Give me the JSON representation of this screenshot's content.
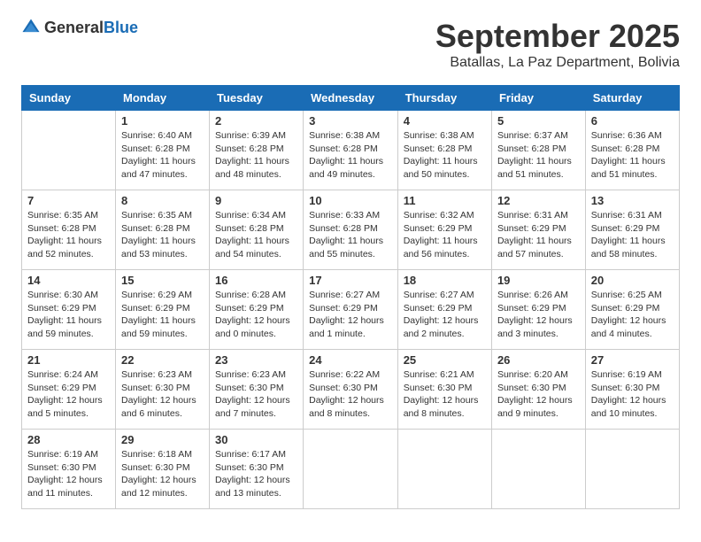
{
  "logo": {
    "text_general": "General",
    "text_blue": "Blue"
  },
  "title": "September 2025",
  "location": "Batallas, La Paz Department, Bolivia",
  "days_of_week": [
    "Sunday",
    "Monday",
    "Tuesday",
    "Wednesday",
    "Thursday",
    "Friday",
    "Saturday"
  ],
  "weeks": [
    [
      {
        "day": null,
        "info": null
      },
      {
        "day": "1",
        "info": "Sunrise: 6:40 AM\nSunset: 6:28 PM\nDaylight: 11 hours\nand 47 minutes."
      },
      {
        "day": "2",
        "info": "Sunrise: 6:39 AM\nSunset: 6:28 PM\nDaylight: 11 hours\nand 48 minutes."
      },
      {
        "day": "3",
        "info": "Sunrise: 6:38 AM\nSunset: 6:28 PM\nDaylight: 11 hours\nand 49 minutes."
      },
      {
        "day": "4",
        "info": "Sunrise: 6:38 AM\nSunset: 6:28 PM\nDaylight: 11 hours\nand 50 minutes."
      },
      {
        "day": "5",
        "info": "Sunrise: 6:37 AM\nSunset: 6:28 PM\nDaylight: 11 hours\nand 51 minutes."
      },
      {
        "day": "6",
        "info": "Sunrise: 6:36 AM\nSunset: 6:28 PM\nDaylight: 11 hours\nand 51 minutes."
      }
    ],
    [
      {
        "day": "7",
        "info": "Sunrise: 6:35 AM\nSunset: 6:28 PM\nDaylight: 11 hours\nand 52 minutes."
      },
      {
        "day": "8",
        "info": "Sunrise: 6:35 AM\nSunset: 6:28 PM\nDaylight: 11 hours\nand 53 minutes."
      },
      {
        "day": "9",
        "info": "Sunrise: 6:34 AM\nSunset: 6:28 PM\nDaylight: 11 hours\nand 54 minutes."
      },
      {
        "day": "10",
        "info": "Sunrise: 6:33 AM\nSunset: 6:28 PM\nDaylight: 11 hours\nand 55 minutes."
      },
      {
        "day": "11",
        "info": "Sunrise: 6:32 AM\nSunset: 6:29 PM\nDaylight: 11 hours\nand 56 minutes."
      },
      {
        "day": "12",
        "info": "Sunrise: 6:31 AM\nSunset: 6:29 PM\nDaylight: 11 hours\nand 57 minutes."
      },
      {
        "day": "13",
        "info": "Sunrise: 6:31 AM\nSunset: 6:29 PM\nDaylight: 11 hours\nand 58 minutes."
      }
    ],
    [
      {
        "day": "14",
        "info": "Sunrise: 6:30 AM\nSunset: 6:29 PM\nDaylight: 11 hours\nand 59 minutes."
      },
      {
        "day": "15",
        "info": "Sunrise: 6:29 AM\nSunset: 6:29 PM\nDaylight: 11 hours\nand 59 minutes."
      },
      {
        "day": "16",
        "info": "Sunrise: 6:28 AM\nSunset: 6:29 PM\nDaylight: 12 hours\nand 0 minutes."
      },
      {
        "day": "17",
        "info": "Sunrise: 6:27 AM\nSunset: 6:29 PM\nDaylight: 12 hours\nand 1 minute."
      },
      {
        "day": "18",
        "info": "Sunrise: 6:27 AM\nSunset: 6:29 PM\nDaylight: 12 hours\nand 2 minutes."
      },
      {
        "day": "19",
        "info": "Sunrise: 6:26 AM\nSunset: 6:29 PM\nDaylight: 12 hours\nand 3 minutes."
      },
      {
        "day": "20",
        "info": "Sunrise: 6:25 AM\nSunset: 6:29 PM\nDaylight: 12 hours\nand 4 minutes."
      }
    ],
    [
      {
        "day": "21",
        "info": "Sunrise: 6:24 AM\nSunset: 6:29 PM\nDaylight: 12 hours\nand 5 minutes."
      },
      {
        "day": "22",
        "info": "Sunrise: 6:23 AM\nSunset: 6:30 PM\nDaylight: 12 hours\nand 6 minutes."
      },
      {
        "day": "23",
        "info": "Sunrise: 6:23 AM\nSunset: 6:30 PM\nDaylight: 12 hours\nand 7 minutes."
      },
      {
        "day": "24",
        "info": "Sunrise: 6:22 AM\nSunset: 6:30 PM\nDaylight: 12 hours\nand 8 minutes."
      },
      {
        "day": "25",
        "info": "Sunrise: 6:21 AM\nSunset: 6:30 PM\nDaylight: 12 hours\nand 8 minutes."
      },
      {
        "day": "26",
        "info": "Sunrise: 6:20 AM\nSunset: 6:30 PM\nDaylight: 12 hours\nand 9 minutes."
      },
      {
        "day": "27",
        "info": "Sunrise: 6:19 AM\nSunset: 6:30 PM\nDaylight: 12 hours\nand 10 minutes."
      }
    ],
    [
      {
        "day": "28",
        "info": "Sunrise: 6:19 AM\nSunset: 6:30 PM\nDaylight: 12 hours\nand 11 minutes."
      },
      {
        "day": "29",
        "info": "Sunrise: 6:18 AM\nSunset: 6:30 PM\nDaylight: 12 hours\nand 12 minutes."
      },
      {
        "day": "30",
        "info": "Sunrise: 6:17 AM\nSunset: 6:30 PM\nDaylight: 12 hours\nand 13 minutes."
      },
      {
        "day": null,
        "info": null
      },
      {
        "day": null,
        "info": null
      },
      {
        "day": null,
        "info": null
      },
      {
        "day": null,
        "info": null
      }
    ]
  ]
}
